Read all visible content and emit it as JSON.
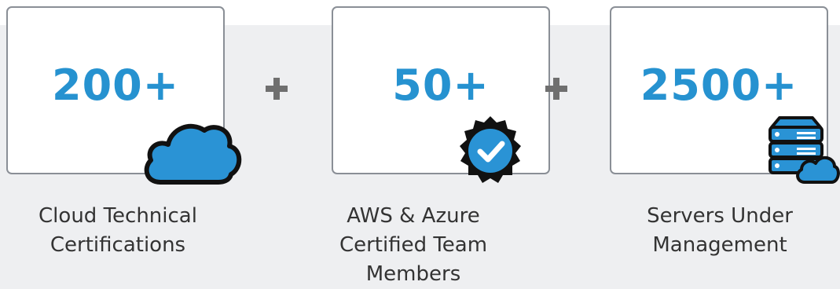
{
  "stats": [
    {
      "value": "200+",
      "caption_lines": [
        "Cloud Technical",
        "Certifications"
      ],
      "icon": "cloud-icon"
    },
    {
      "value": "50+",
      "caption_lines": [
        "AWS & Azure",
        "Certified Team",
        "Members"
      ],
      "icon": "verified-badge-icon"
    },
    {
      "value": "2500+",
      "caption_lines": [
        "Servers Under",
        "Management"
      ],
      "icon": "server-cloud-icon"
    }
  ],
  "separator_icon": "plus-icon",
  "colors": {
    "accent": "#2692d0",
    "icon_fill": "#2a93d5",
    "dark": "#111111",
    "separator": "#6f6f6f",
    "band": "#eeeff1"
  }
}
